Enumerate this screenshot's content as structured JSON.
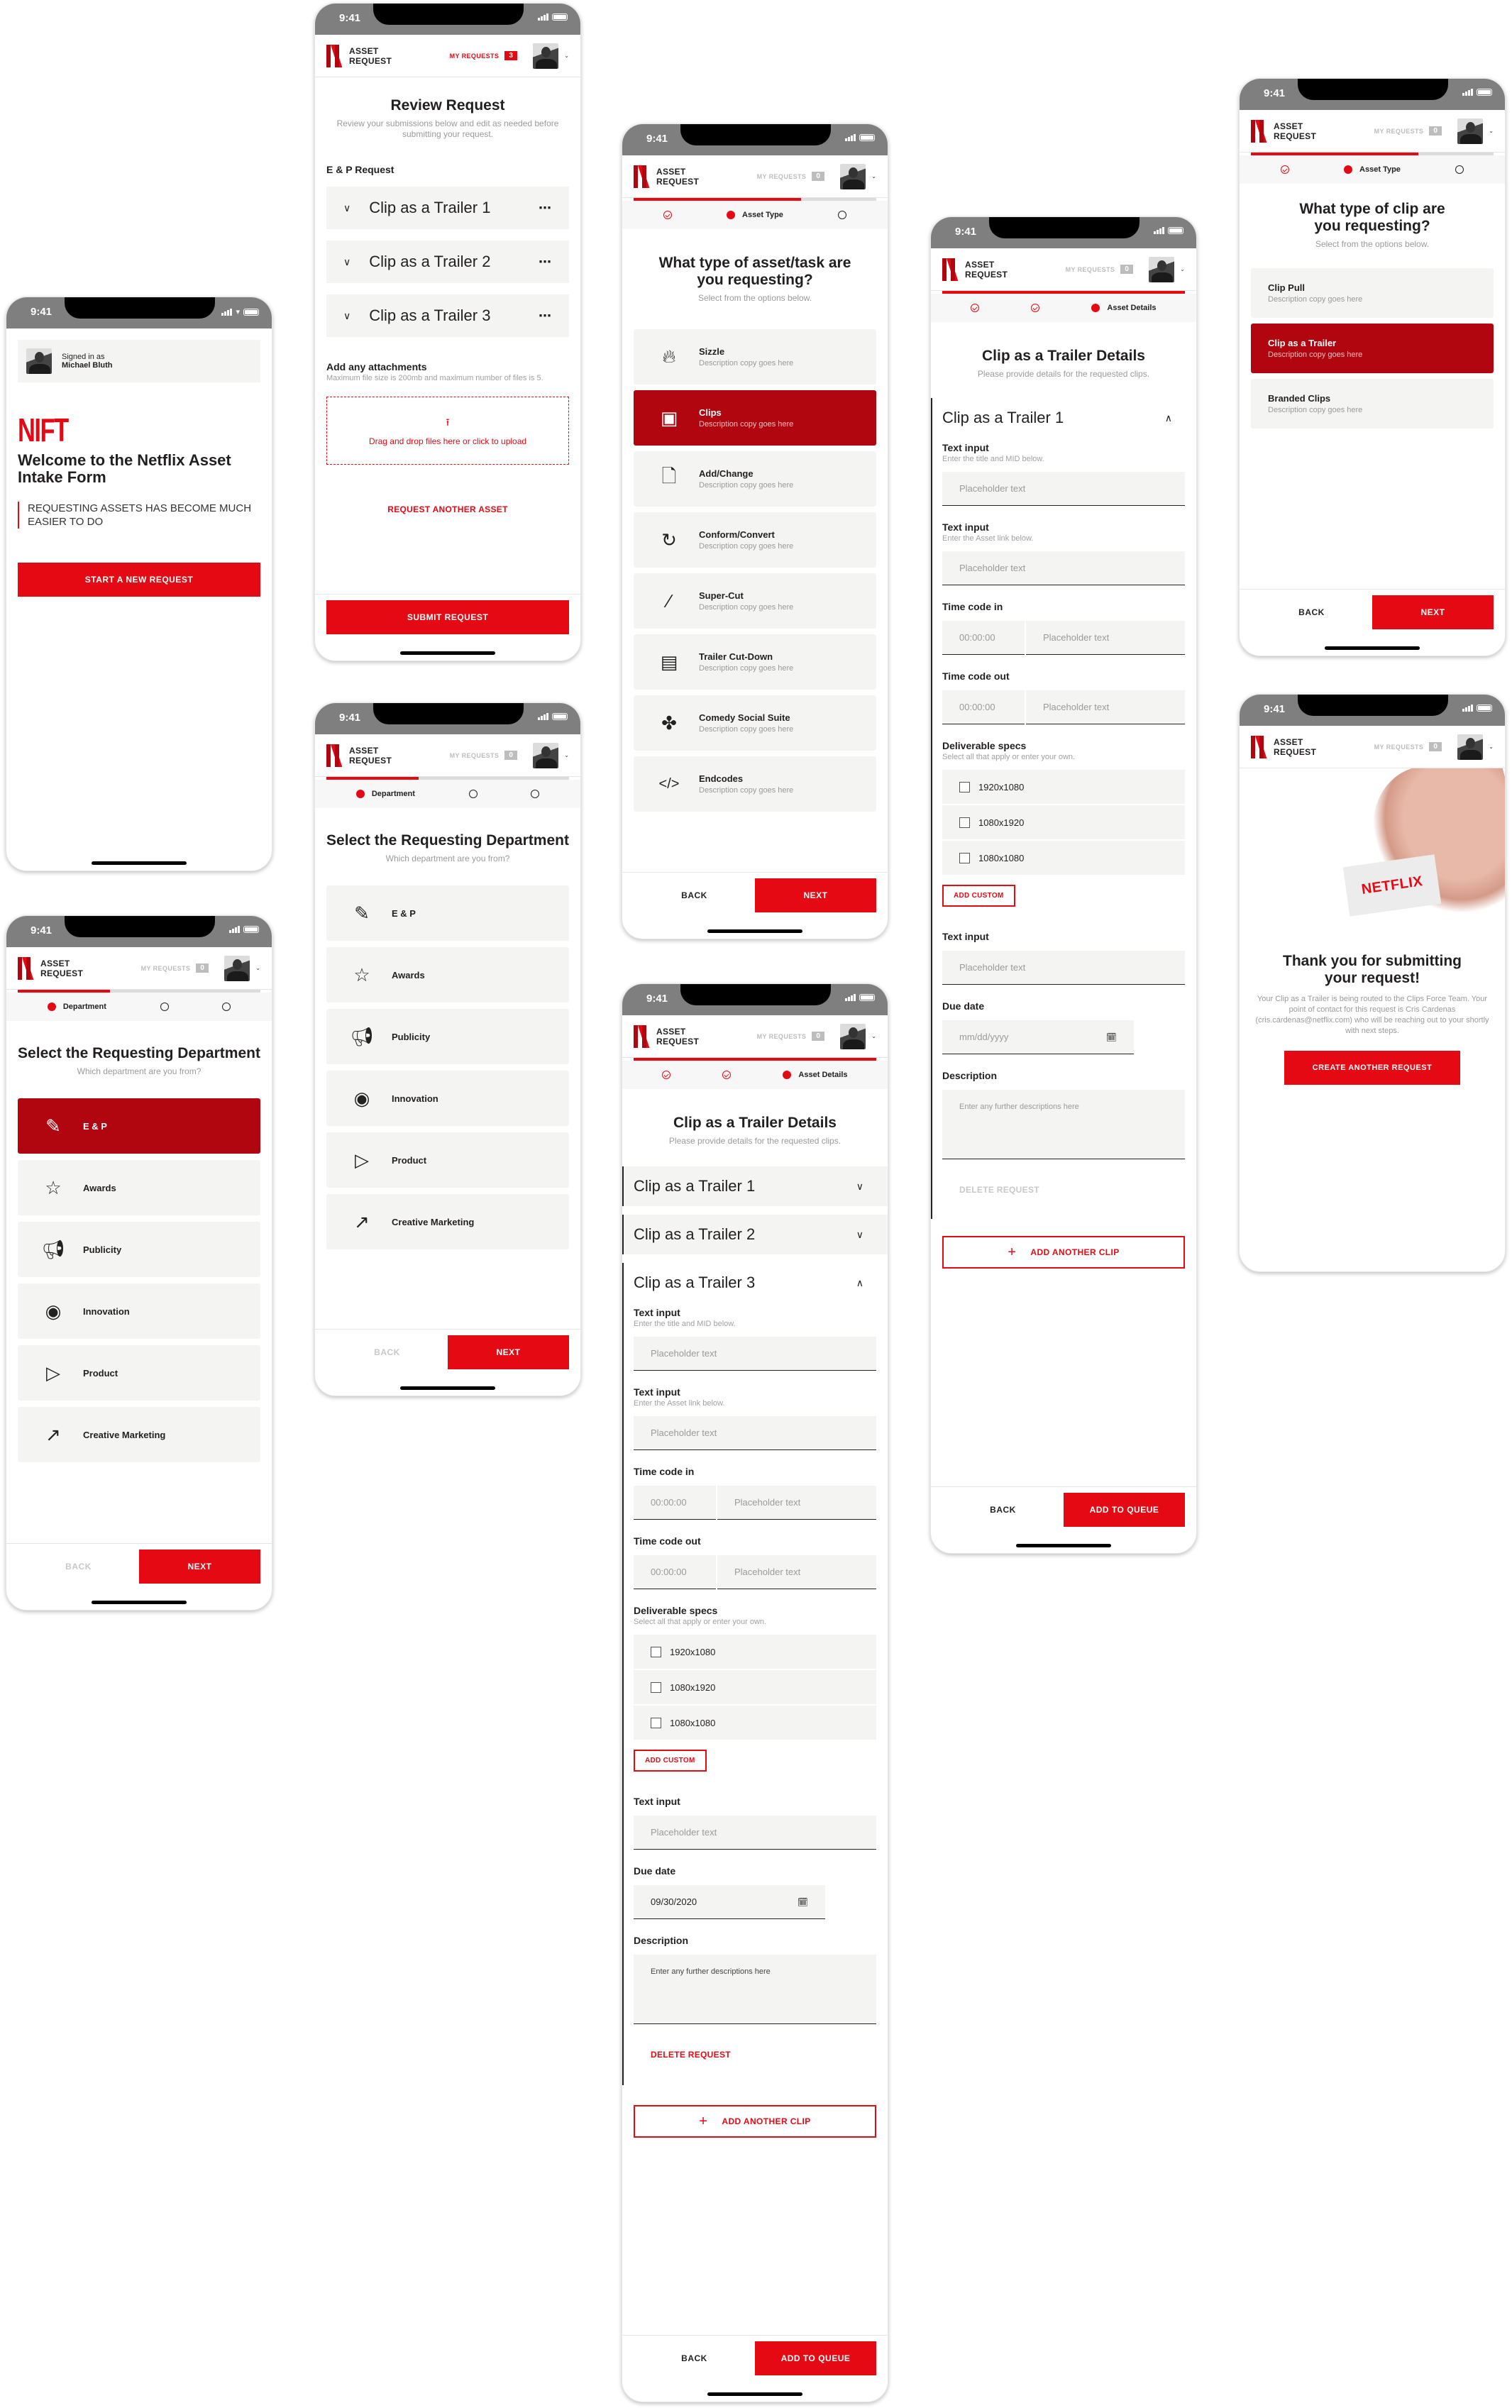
{
  "common": {
    "status_time": "9:41",
    "app_title_line1": "ASSET",
    "app_title_line2": "REQUEST",
    "my_requests_label": "MY REQUESTS",
    "user_name": "Michael Bluth",
    "back_label": "BACK",
    "next_label": "NEXT",
    "colors": {
      "brand_red": "#e50914",
      "selected_red": "#b1060f",
      "tile_bg": "#f4f4f2"
    }
  },
  "welcome": {
    "signed_in_label": "Signed in as",
    "user_name": "Michael Bluth",
    "logo_text": "NIFT",
    "title": "Welcome to the Netflix Asset Intake Form",
    "tagline": "REQUESTING ASSETS HAS BECOME MUCH EASIER TO DO",
    "start_button": "START A NEW REQUEST"
  },
  "review": {
    "my_requests_count": "3",
    "title": "Review Request",
    "subtitle": "Review your submissions below and edit as needed before submitting your request.",
    "section_label": "E & P Request",
    "items": [
      "Clip as a Trailer 1",
      "Clip as a Trailer 2",
      "Clip as a Trailer 3"
    ],
    "attachments_title": "Add any attachments",
    "attachments_hint": "Maximum file size is 200mb and maximum number of files is 5.",
    "dropzone_text": "Drag and drop files here or click to upload",
    "request_another": "REQUEST ANOTHER ASSET",
    "submit_button": "SUBMIT REQUEST"
  },
  "department": {
    "my_requests_count": "0",
    "progress": 0.38,
    "step_label": "Department",
    "title": "Select the Requesting Department",
    "subtitle": "Which department are you from?",
    "options": [
      {
        "label": "E & P",
        "icon": "document-pen-icon"
      },
      {
        "label": "Awards",
        "icon": "trophy-icon"
      },
      {
        "label": "Publicity",
        "icon": "megaphone-icon"
      },
      {
        "label": "Innovation",
        "icon": "eye-icon"
      },
      {
        "label": "Product",
        "icon": "monitor-play-icon"
      },
      {
        "label": "Creative Marketing",
        "icon": "rocket-icon"
      }
    ],
    "selected_index_variant_b": 0
  },
  "asset_type": {
    "my_requests_count": "0",
    "progress": 0.69,
    "step_label": "Asset Type",
    "title": "What type of asset/task are you requesting?",
    "subtitle": "Select from the options below.",
    "options": [
      {
        "label": "Sizzle",
        "desc": "Description copy goes here",
        "icon": "flame-icon"
      },
      {
        "label": "Clips",
        "desc": "Description copy goes here",
        "icon": "film-clip-icon"
      },
      {
        "label": "Add/Change",
        "desc": "Description copy goes here",
        "icon": "file-add-icon"
      },
      {
        "label": "Conform/Convert",
        "desc": "Description copy goes here",
        "icon": "convert-icon"
      },
      {
        "label": "Super-Cut",
        "desc": "Description copy goes here",
        "icon": "knife-icon"
      },
      {
        "label": "Trailer Cut-Down",
        "desc": "Description copy goes here",
        "icon": "clapperboard-icon"
      },
      {
        "label": "Comedy Social Suite",
        "desc": "Description copy goes here",
        "icon": "network-icon"
      },
      {
        "label": "Endcodes",
        "desc": "Description copy goes here",
        "icon": "code-icon"
      }
    ],
    "selected_index": 1
  },
  "clip_type": {
    "my_requests_count": "0",
    "progress": 0.69,
    "step_label": "Asset Type",
    "title": "What type of clip are you requesting?",
    "subtitle": "Select from the options below.",
    "options": [
      {
        "label": "Clip Pull",
        "desc": "Description copy goes here"
      },
      {
        "label": "Clip as a Trailer",
        "desc": "Description copy goes here"
      },
      {
        "label": "Branded Clips",
        "desc": "Description copy goes here"
      }
    ],
    "selected_index": 1
  },
  "details": {
    "my_requests_count": "0",
    "progress": 1.0,
    "step_label": "Asset Details",
    "title": "Clip as a Trailer Details",
    "subtitle": "Please provide details for the requested clips.",
    "accordions": [
      "Clip as a Trailer 1",
      "Clip as a Trailer 2",
      "Clip as a Trailer 3"
    ],
    "text_input_label": "Text input",
    "text_input_hint_1": "Enter the title and MID below.",
    "text_input_hint_2": "Enter the Asset link below.",
    "placeholder": "Placeholder text",
    "time_code_in_label": "Time code in",
    "time_code_out_label": "Time code out",
    "time_placeholder": "00:00:00",
    "deliverable_label": "Deliverable specs",
    "deliverable_hint": "Select all that apply or enter your own.",
    "specs": [
      "1920x1080",
      "1080x1920",
      "1080x1080"
    ],
    "add_custom": "ADD CUSTOM",
    "due_date_label": "Due date",
    "due_date_placeholder": "mm/dd/yyyy",
    "due_date_value": "09/30/2020",
    "description_label": "Description",
    "description_placeholder": "Enter any further descriptions here",
    "delete_request": "DELETE REQUEST",
    "add_another_clip": "ADD ANOTHER  CLIP",
    "add_to_queue": "ADD TO QUEUE"
  },
  "thanks": {
    "my_requests_count": "0",
    "ticket_text": "NETFLIX",
    "title": "Thank you for submitting your request!",
    "body": "Your Clip as a Trailer is being routed to the Clips Force Team. Your point of contact for this request is Cris Cardenas (cris.cardenas@netflix.com) who will be reaching out to your shortly with next steps.",
    "button": "CREATE ANOTHER REQUEST"
  }
}
